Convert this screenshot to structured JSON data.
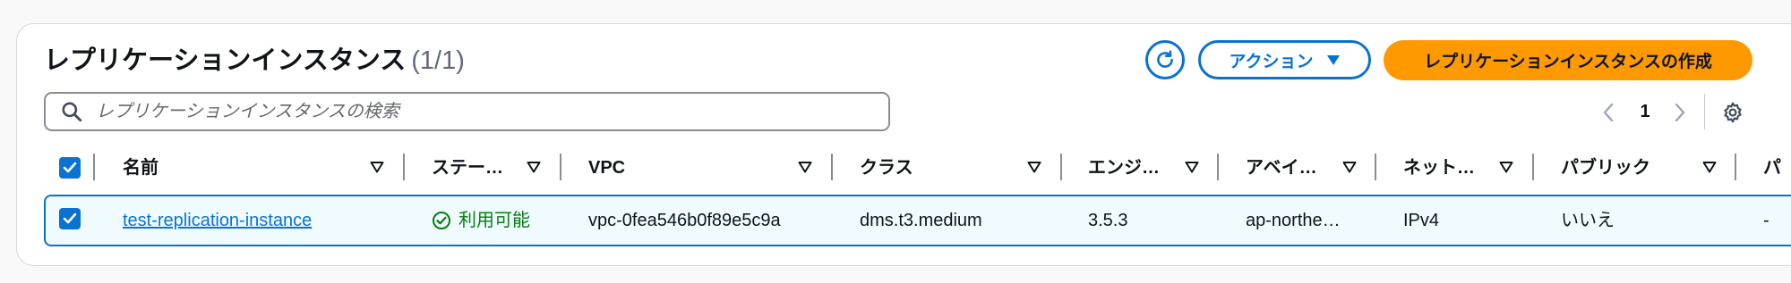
{
  "header": {
    "title": "レプリケーションインスタンス",
    "count": "(1/1)",
    "actions_label": "アクション",
    "create_label": "レプリケーションインスタンスの作成"
  },
  "search": {
    "placeholder": "レプリケーションインスタンスの検索",
    "value": ""
  },
  "pagination": {
    "current_page": "1"
  },
  "table": {
    "columns": [
      "名前",
      "ステー…",
      "VPC",
      "クラス",
      "エンジ…",
      "アベイ…",
      "ネット…",
      "パブリック",
      "パ"
    ],
    "rows": [
      {
        "selected": true,
        "name": "test-replication-instance",
        "status": "利用可能",
        "vpc": "vpc-0fea546b0f89e5c9a",
        "class": "dms.t3.medium",
        "engine": "3.5.3",
        "availability": "ap-northe…",
        "network": "IPv4",
        "public": "いいえ",
        "extra": "-"
      }
    ]
  },
  "colors": {
    "accent": "#0972d3",
    "primary_button": "#ff9900",
    "success": "#037f0c",
    "selected_row_bg": "#f0fbff"
  },
  "icons": [
    "refresh-icon",
    "caret-down-icon",
    "search-icon",
    "chevron-left-icon",
    "chevron-right-icon",
    "gear-icon",
    "sort-icon",
    "check-icon",
    "status-ok-icon"
  ]
}
